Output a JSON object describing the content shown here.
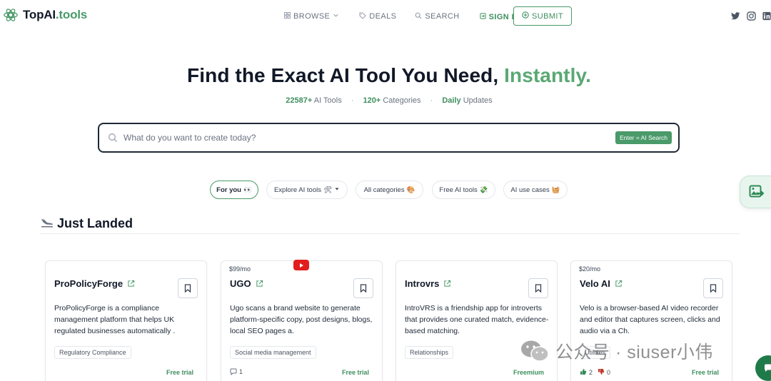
{
  "brand": {
    "name_prefix": "TopAI",
    "name_suffix": ".tools"
  },
  "nav": {
    "browse": "BROWSE",
    "deals": "DEALS",
    "search": "SEARCH",
    "sign_in": "SIGN IN",
    "submit": "SUBMIT"
  },
  "social": [
    "twitter-icon",
    "instagram-icon",
    "linkedin-icon"
  ],
  "hero": {
    "title_main": "Find the Exact AI Tool You Need,",
    "title_accent": "Instantly.",
    "stats": [
      {
        "value": "22587+",
        "label": "AI Tools"
      },
      {
        "value": "120+",
        "label": "Categories"
      },
      {
        "value": "Daily",
        "label": "Updates"
      }
    ]
  },
  "search": {
    "placeholder": "What do you want to create today?",
    "value": "",
    "ai_button": "Enter = AI Search"
  },
  "filters": [
    {
      "label": "For you",
      "emoji": "👀",
      "active": true
    },
    {
      "label": "Explore AI tools",
      "emoji": "🛠",
      "dropdown": true
    },
    {
      "label": "All categories",
      "emoji": "🎨"
    },
    {
      "label": "Free AI tools",
      "emoji": "💸"
    },
    {
      "label": "AI use cases",
      "emoji": "🧺"
    }
  ],
  "section": {
    "title": "Just Landed",
    "emoji": "🛬"
  },
  "cards": [
    {
      "price": "",
      "name": "ProPolicyForge",
      "description": "ProPolicyForge is a compliance management platform that helps UK regulated businesses automatically .",
      "tag": "Regulatory Compliance",
      "pricing": "Free trial",
      "meta": ""
    },
    {
      "price": "$99/mo",
      "name": "UGO",
      "description": "Ugo scans a brand website to generate platform-specific copy, post designs, blogs, local SEO pages a.",
      "tag": "Social media management",
      "pricing": "Free trial",
      "meta": "1"
    },
    {
      "price": "",
      "name": "Introvrs",
      "description": "IntroVRS is a friendship app for introverts that provides one curated match, evidence-based matching.",
      "tag": "Relationships",
      "pricing": "Freemium",
      "meta": ""
    },
    {
      "price": "$20/mo",
      "name": "Velo AI",
      "description": "Velo is a browser-based AI video recorder and editor that captures screen, clicks and audio via a Ch.",
      "tag": "Utilities",
      "pricing": "Free trial",
      "meta_up": "2",
      "meta_down": "0"
    }
  ],
  "watermark": {
    "text": "公众号 · siuser小伟"
  },
  "colors": {
    "accent": "#4a9a6a",
    "accent_light": "#5aa874",
    "text": "#111827"
  }
}
